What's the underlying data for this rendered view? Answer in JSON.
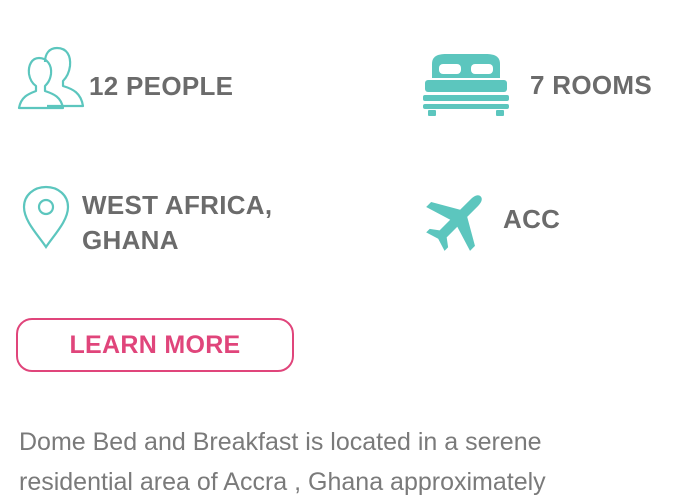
{
  "features": {
    "people": {
      "label": "12 PEOPLE",
      "icon": "people-icon"
    },
    "rooms": {
      "label": "7 ROOMS",
      "icon": "bed-icon"
    },
    "location": {
      "label_line1": "WEST AFRICA,",
      "label_line2": "GHANA",
      "icon": "map-pin-icon"
    },
    "airport": {
      "label": "ACC",
      "icon": "airplane-icon"
    }
  },
  "cta": {
    "label": "LEARN MORE"
  },
  "description": {
    "line1": "Dome Bed and Breakfast is located in a serene",
    "line2": "residential area of Accra , Ghana approximately"
  },
  "colors": {
    "icon_teal": "#5cc6be",
    "accent_pink": "#e0457b",
    "label_gray": "#6b6b6b"
  }
}
